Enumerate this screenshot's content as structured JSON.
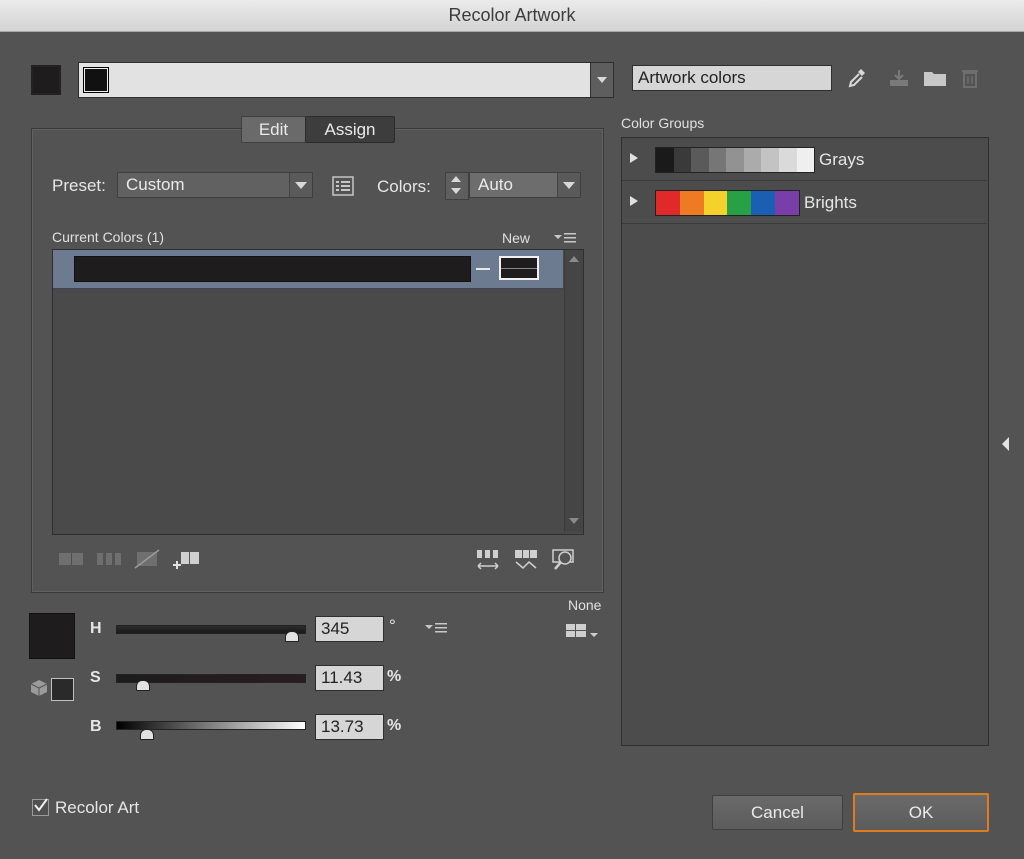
{
  "window": {
    "title": "Recolor Artwork"
  },
  "toolbar": {
    "harmony_field_value": "",
    "group_name_value": "Artwork colors"
  },
  "tabs": {
    "edit": "Edit",
    "assign": "Assign"
  },
  "preset": {
    "label": "Preset:",
    "value": "Custom"
  },
  "colors": {
    "label": "Colors:",
    "value": "Auto"
  },
  "list": {
    "current_colors_header": "Current Colors (1)",
    "new_header": "New"
  },
  "hsb": {
    "h_label": "H",
    "h_value": "345",
    "h_unit": "°",
    "s_label": "S",
    "s_value": "11.43",
    "s_unit": "%",
    "b_label": "B",
    "b_value": "13.73",
    "b_unit": "%",
    "h_level": 0.958,
    "s_level": 0.1143,
    "b_level": 0.1373
  },
  "none_label": "None",
  "color_groups": {
    "header": "Color Groups",
    "groups": [
      {
        "name": "Grays",
        "colors": [
          "#1a1a1a",
          "#3a3a3a",
          "#5a5a5a",
          "#767676",
          "#929292",
          "#ababab",
          "#c3c3c3",
          "#dadada",
          "#efefef"
        ]
      },
      {
        "name": "Brights",
        "colors": [
          "#e02a2a",
          "#ef7a24",
          "#f3d22c",
          "#27a046",
          "#1b5fb5",
          "#7a3ea8"
        ]
      }
    ]
  },
  "footer": {
    "recolor_art_label": "Recolor Art",
    "recolor_art_checked": true,
    "cancel": "Cancel",
    "ok": "OK"
  },
  "accent_colors": {
    "ok_border": "#e07b1f",
    "selected_row": "#6c7b90"
  }
}
